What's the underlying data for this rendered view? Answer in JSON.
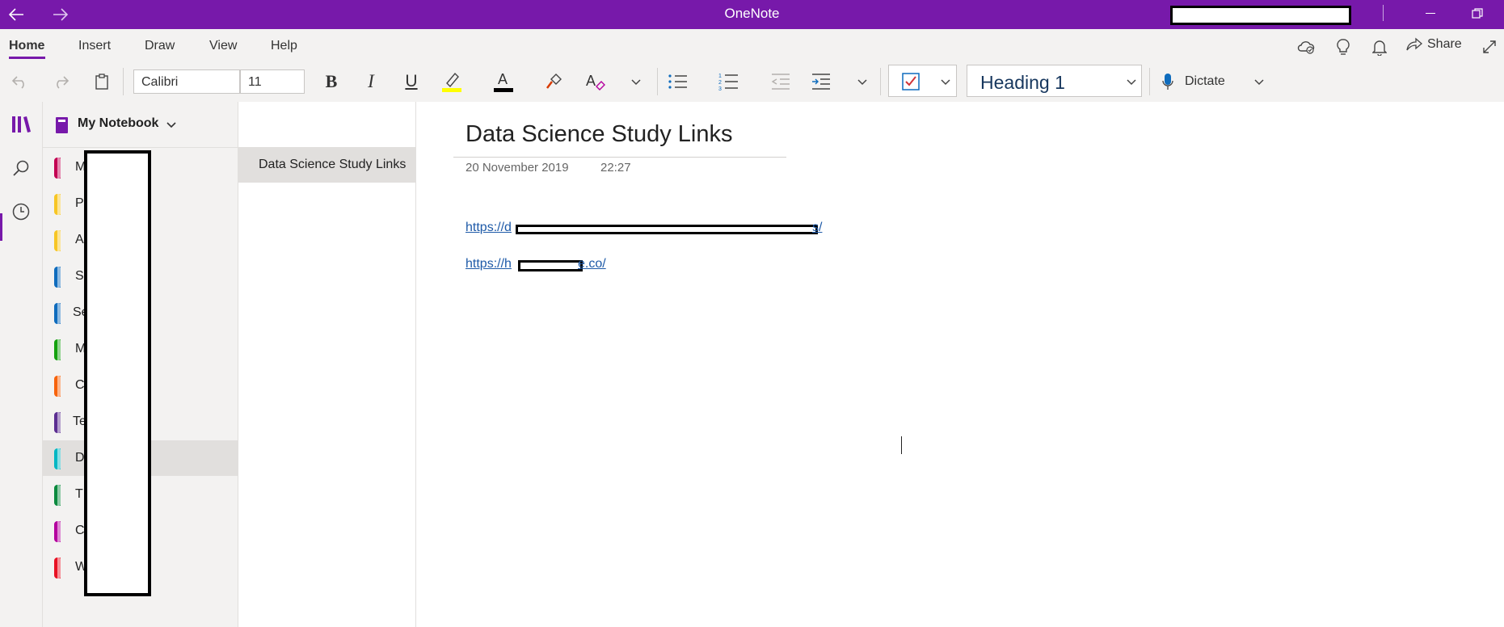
{
  "titlebar": {
    "app_title": "OneNote",
    "back_icon": "arrow-left-icon",
    "forward_icon": "arrow-right-icon"
  },
  "menu": {
    "tabs": [
      "Home",
      "Insert",
      "Draw",
      "View",
      "Help"
    ],
    "active": "Home"
  },
  "actions": {
    "share_label": "Share"
  },
  "toolbar": {
    "font_name": "Calibri",
    "font_size": "11",
    "style": "Heading 1",
    "dictate_label": "Dictate",
    "highlight_color": "#ffff00",
    "font_color": "#000000"
  },
  "notebook": {
    "name": "My Notebook",
    "sections": [
      {
        "label": "M          s",
        "color": "#c30052"
      },
      {
        "label": "P",
        "color": "#f7c624"
      },
      {
        "label": "A          s",
        "color": "#f7c624"
      },
      {
        "label": "S          Tools",
        "color": "#0f6cbd"
      },
      {
        "label": "Se          s",
        "color": "#0f6cbd"
      },
      {
        "label": "M",
        "color": "#13a10e"
      },
      {
        "label": "C",
        "color": "#f7630c"
      },
      {
        "label": "Te          on",
        "color": "#5c2e91"
      },
      {
        "label": "D",
        "color": "#00b7c3"
      },
      {
        "label": "T",
        "color": "#0b8a3e"
      },
      {
        "label": "C          gs",
        "color": "#b4009e"
      },
      {
        "label": "W          es",
        "color": "#e81123"
      }
    ]
  },
  "pages": [
    {
      "label": "Data Science Study Links"
    }
  ],
  "note": {
    "title": "Data Science Study Links",
    "date": "20 November 2019",
    "time": "22:27",
    "links": [
      {
        "prefix": "https://d",
        "suffix": "s/"
      },
      {
        "prefix": "https://h",
        "suffix": "e.co/"
      }
    ]
  },
  "colors": {
    "accent": "#7719aa"
  }
}
